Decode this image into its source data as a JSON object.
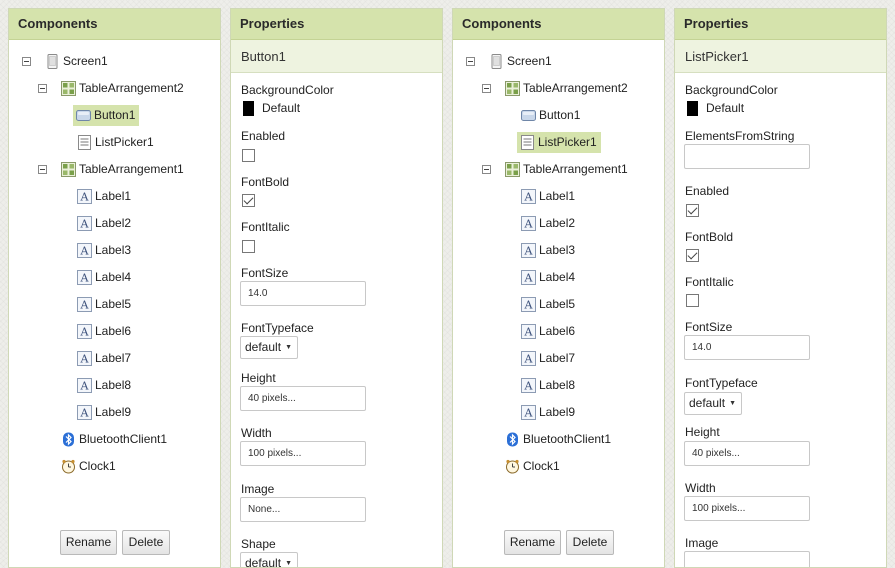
{
  "left_components": {
    "header": "Components",
    "nodes": [
      {
        "label": "Screen1",
        "icon": "screen-icon"
      },
      {
        "label": "TableArrangement2",
        "icon": "table-arrangement-icon"
      },
      {
        "label": "Button1",
        "icon": "button-icon",
        "selected": true
      },
      {
        "label": "ListPicker1",
        "icon": "listpicker-icon"
      },
      {
        "label": "TableArrangement1",
        "icon": "table-arrangement-icon"
      },
      {
        "label": "Label1",
        "icon": "label-icon"
      },
      {
        "label": "Label2",
        "icon": "label-icon"
      },
      {
        "label": "Label3",
        "icon": "label-icon"
      },
      {
        "label": "Label4",
        "icon": "label-icon"
      },
      {
        "label": "Label5",
        "icon": "label-icon"
      },
      {
        "label": "Label6",
        "icon": "label-icon"
      },
      {
        "label": "Label7",
        "icon": "label-icon"
      },
      {
        "label": "Label8",
        "icon": "label-icon"
      },
      {
        "label": "Label9",
        "icon": "label-icon"
      },
      {
        "label": "BluetoothClient1",
        "icon": "bluetooth-icon"
      },
      {
        "label": "Clock1",
        "icon": "clock-icon"
      }
    ],
    "rename_label": "Rename",
    "delete_label": "Delete"
  },
  "left_properties": {
    "header": "Properties",
    "component": "Button1",
    "background_color_label": "BackgroundColor",
    "background_color_value": "Default",
    "enabled_label": "Enabled",
    "enabled": false,
    "fontbold_label": "FontBold",
    "fontbold": true,
    "fontitalic_label": "FontItalic",
    "fontitalic": false,
    "fontsize_label": "FontSize",
    "fontsize_value": "14.0",
    "fonttypeface_label": "FontTypeface",
    "fonttypeface_value": "default",
    "height_label": "Height",
    "height_value": "40 pixels...",
    "width_label": "Width",
    "width_value": "100 pixels...",
    "image_label": "Image",
    "image_value": "None...",
    "shape_label": "Shape",
    "shape_value": "default"
  },
  "right_components": {
    "header": "Components",
    "nodes": [
      {
        "label": "Screen1",
        "icon": "screen-icon"
      },
      {
        "label": "TableArrangement2",
        "icon": "table-arrangement-icon"
      },
      {
        "label": "Button1",
        "icon": "button-icon"
      },
      {
        "label": "ListPicker1",
        "icon": "listpicker-icon",
        "selected": true
      },
      {
        "label": "TableArrangement1",
        "icon": "table-arrangement-icon"
      },
      {
        "label": "Label1",
        "icon": "label-icon"
      },
      {
        "label": "Label2",
        "icon": "label-icon"
      },
      {
        "label": "Label3",
        "icon": "label-icon"
      },
      {
        "label": "Label4",
        "icon": "label-icon"
      },
      {
        "label": "Label5",
        "icon": "label-icon"
      },
      {
        "label": "Label6",
        "icon": "label-icon"
      },
      {
        "label": "Label7",
        "icon": "label-icon"
      },
      {
        "label": "Label8",
        "icon": "label-icon"
      },
      {
        "label": "Label9",
        "icon": "label-icon"
      },
      {
        "label": "BluetoothClient1",
        "icon": "bluetooth-icon"
      },
      {
        "label": "Clock1",
        "icon": "clock-icon"
      }
    ],
    "rename_label": "Rename",
    "delete_label": "Delete"
  },
  "right_properties": {
    "header": "Properties",
    "component": "ListPicker1",
    "background_color_label": "BackgroundColor",
    "background_color_value": "Default",
    "elements_label": "ElementsFromString",
    "elements_value": "",
    "enabled_label": "Enabled",
    "enabled": true,
    "fontbold_label": "FontBold",
    "fontbold": true,
    "fontitalic_label": "FontItalic",
    "fontitalic": false,
    "fontsize_label": "FontSize",
    "fontsize_value": "14.0",
    "fonttypeface_label": "FontTypeface",
    "fonttypeface_value": "default",
    "height_label": "Height",
    "height_value": "40 pixels...",
    "width_label": "Width",
    "width_value": "100 pixels...",
    "image_label": "Image"
  },
  "colors": {
    "header_bg": "#d5e3ac",
    "selection_bg": "#d5e3ac",
    "subheader_bg": "#eef3e0"
  }
}
